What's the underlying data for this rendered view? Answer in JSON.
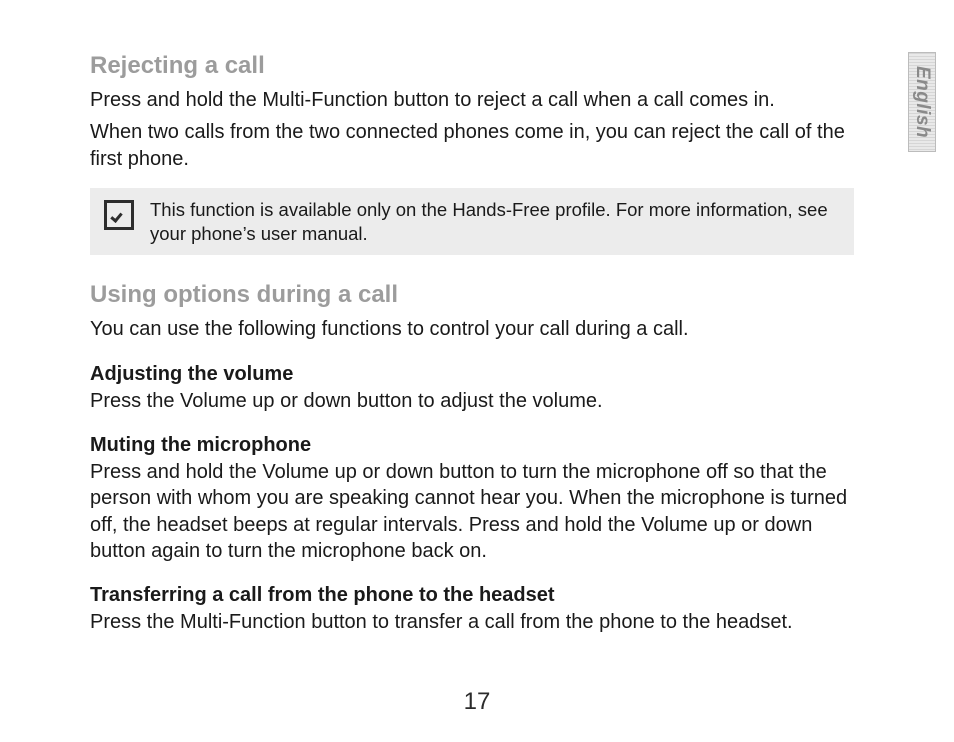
{
  "language_tab": "English",
  "sections": {
    "rejecting": {
      "heading": "Rejecting a call",
      "p1": "Press and hold the Multi-Function button to reject a call when a call comes in.",
      "p2": "When two calls from the two connected phones come in, you can reject the call of the first phone."
    },
    "note": "This function is available only on the Hands-Free profile. For more information, see your phone’s user manual.",
    "using": {
      "heading": "Using options during a call",
      "intro": "You can use the following functions to control your call during a call.",
      "volume": {
        "heading": "Adjusting the volume",
        "body": "Press the Volume up or down button to adjust the volume."
      },
      "mute": {
        "heading": "Muting the microphone",
        "body": "Press and hold the Volume up or down button to turn the microphone off so that the person with whom you are speaking cannot hear you. When the microphone is turned off, the headset beeps at regular intervals. Press and hold the Volume up or down button again to turn the microphone back on."
      },
      "transfer": {
        "heading": "Transferring a call from the phone to the headset",
        "body": "Press the Multi-Function button to transfer a call from the phone to the headset."
      }
    }
  },
  "page_number": "17"
}
